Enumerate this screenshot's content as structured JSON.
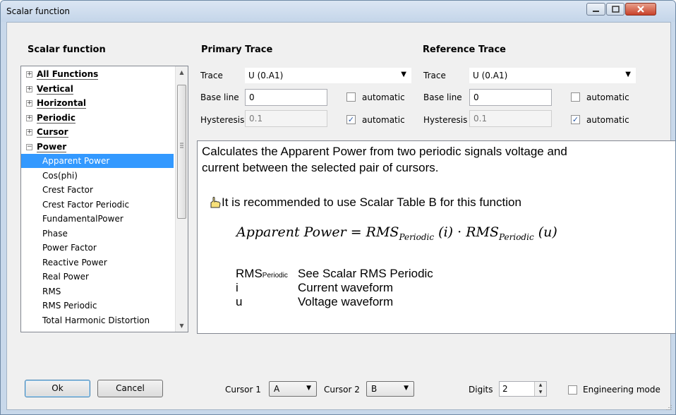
{
  "window": {
    "title": "Scalar function"
  },
  "left": {
    "heading": "Scalar function",
    "items": [
      {
        "label": "All Functions",
        "type": "group",
        "expander": "+"
      },
      {
        "label": "Vertical",
        "type": "group",
        "expander": "+"
      },
      {
        "label": "Horizontal",
        "type": "group",
        "expander": "+"
      },
      {
        "label": "Periodic",
        "type": "group",
        "expander": "+"
      },
      {
        "label": "Cursor",
        "type": "group",
        "expander": "+"
      },
      {
        "label": "Power",
        "type": "group",
        "expander": "−"
      },
      {
        "label": "Apparent Power",
        "type": "child",
        "selected": true
      },
      {
        "label": "Cos(phi)",
        "type": "child"
      },
      {
        "label": "Crest Factor",
        "type": "child"
      },
      {
        "label": "Crest Factor Periodic",
        "type": "child"
      },
      {
        "label": "FundamentalPower",
        "type": "child"
      },
      {
        "label": "Phase",
        "type": "child"
      },
      {
        "label": "Power Factor",
        "type": "child"
      },
      {
        "label": "Reactive Power",
        "type": "child"
      },
      {
        "label": "Real Power",
        "type": "child"
      },
      {
        "label": "RMS",
        "type": "child"
      },
      {
        "label": "RMS Periodic",
        "type": "child"
      },
      {
        "label": "Total Harmonic Distortion",
        "type": "child"
      }
    ]
  },
  "primary": {
    "heading": "Primary Trace",
    "trace_label": "Trace",
    "trace_value": "U (0.A1)",
    "baseline_label": "Base line",
    "baseline_value": "0",
    "baseline_auto_label": "automatic",
    "baseline_auto_checked": false,
    "hysteresis_label": "Hysteresis",
    "hysteresis_value": "0.1",
    "hysteresis_auto_label": "automatic",
    "hysteresis_auto_checked": true
  },
  "reference": {
    "heading": "Reference Trace",
    "trace_label": "Trace",
    "trace_value": "U (0.A1)",
    "baseline_label": "Base line",
    "baseline_value": "0",
    "baseline_auto_label": "automatic",
    "baseline_auto_checked": false,
    "hysteresis_label": "Hysteresis",
    "hysteresis_value": "0.1",
    "hysteresis_auto_label": "automatic",
    "hysteresis_auto_checked": true
  },
  "description": {
    "line1": "Calculates the Apparent Power from two periodic signals voltage and",
    "line2": "current between the selected pair of cursors.",
    "recommend": "It is recommended to use Scalar Table B for this function",
    "formula_lhs": "Apparent Power",
    "formula_eq": " = ",
    "formula_rms": "RMS",
    "formula_sub": "Periodic",
    "formula_i": " (i)",
    "formula_dot": " · ",
    "formula_u": " (u)",
    "legend": [
      {
        "term": "RMS",
        "term_sub": "Periodic",
        "meaning": "See Scalar RMS Periodic"
      },
      {
        "term": "i",
        "term_sub": "",
        "meaning": "Current waveform"
      },
      {
        "term": "u",
        "term_sub": "",
        "meaning": "Voltage waveform"
      }
    ]
  },
  "footer": {
    "ok_label": "Ok",
    "cancel_label": "Cancel",
    "cursor1_label": "Cursor 1",
    "cursor1_value": "A",
    "cursor2_label": "Cursor 2",
    "cursor2_value": "B",
    "digits_label": "Digits",
    "digits_value": "2",
    "engineering_label": "Engineering mode",
    "engineering_checked": false
  }
}
